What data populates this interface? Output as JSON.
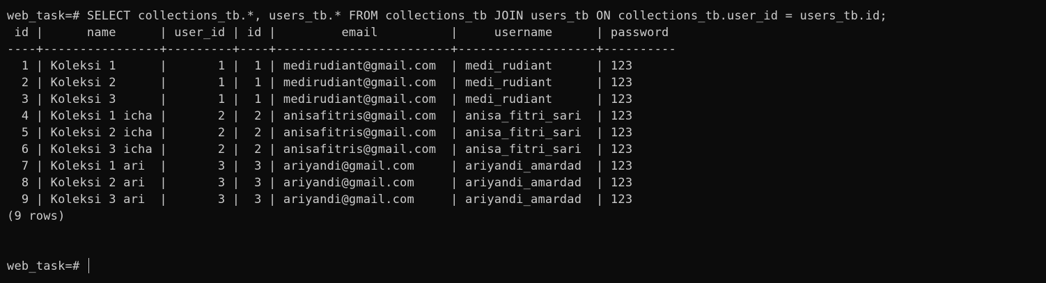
{
  "terminal": {
    "command_line": "web_task=# SELECT collections_tb.*, users_tb.* FROM collections_tb JOIN users_tb ON collections_tb.user_id = users_tb.id;",
    "table": {
      "header": " id |      name      | user_id | id |         email          |     username      | password",
      "separator": "----+----------------+---------+----+------------------------+-------------------+----------",
      "rows": [
        "  1 | Koleksi 1      |       1 |  1 | medirudiant@gmail.com  | medi_rudiant      | 123",
        "  2 | Koleksi 2      |       1 |  1 | medirudiant@gmail.com  | medi_rudiant      | 123",
        "  3 | Koleksi 3      |       1 |  1 | medirudiant@gmail.com  | medi_rudiant      | 123",
        "  4 | Koleksi 1 icha |       2 |  2 | anisafitris@gmail.com  | anisa_fitri_sari  | 123",
        "  5 | Koleksi 2 icha |       2 |  2 | anisafitris@gmail.com  | anisa_fitri_sari  | 123",
        "  6 | Koleksi 3 icha |       2 |  2 | anisafitris@gmail.com  | anisa_fitri_sari  | 123",
        "  7 | Koleksi 1 ari  |       3 |  3 | ariyandi@gmail.com     | ariyandi_amardad  | 123",
        "  8 | Koleksi 2 ari  |       3 |  3 | ariyandi@gmail.com     | ariyandi_amardad  | 123",
        "  9 | Koleksi 3 ari  |       3 |  3 | ariyandi@gmail.com     | ariyandi_amardad  | 123"
      ]
    },
    "row_count": "(9 rows)",
    "prompt": "web_task=# "
  },
  "colors": {
    "background": "#0c0c0c",
    "foreground": "#cccccc"
  }
}
